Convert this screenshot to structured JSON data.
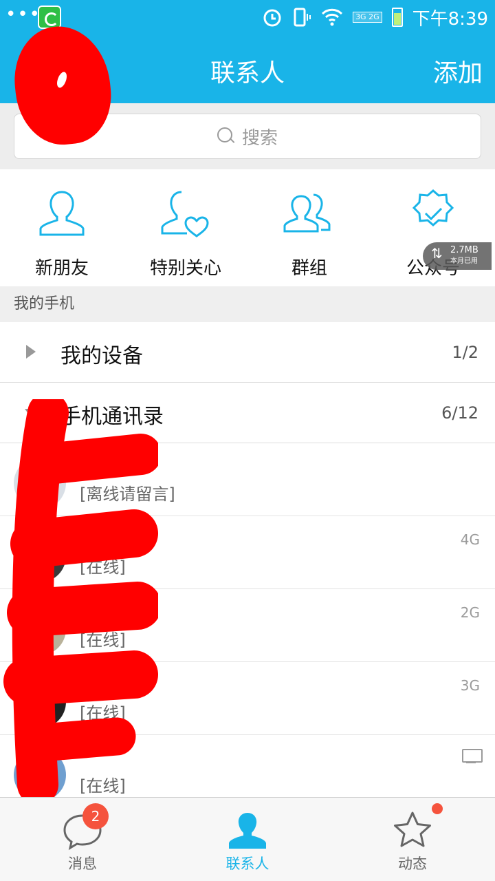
{
  "status_bar": {
    "dots": "•••",
    "net_badge": "3G 2G",
    "time": "下午8:39"
  },
  "header": {
    "title": "联系人",
    "add_label": "添加"
  },
  "search": {
    "placeholder": "搜索"
  },
  "quick_entries": [
    {
      "label": "新朋友",
      "icon": "new-friend-icon"
    },
    {
      "label": "特别关心",
      "icon": "special-care-icon"
    },
    {
      "label": "群组",
      "icon": "group-icon"
    },
    {
      "label": "公众号",
      "icon": "official-account-icon"
    }
  ],
  "traffic_overlay": {
    "value": "2.7MB",
    "sub": "本月已用"
  },
  "section": {
    "title": "我的手机"
  },
  "groups": [
    {
      "name": "我的设备",
      "count": "1/2",
      "expanded": false
    },
    {
      "name": "手机通讯录",
      "count": "6/12",
      "expanded": true
    }
  ],
  "contacts": [
    {
      "name": "",
      "status": "[离线请留言]",
      "network": ""
    },
    {
      "name": "",
      "status": "[在线]",
      "network": "4G"
    },
    {
      "name": "",
      "status": "[在线]",
      "network": "2G"
    },
    {
      "name": "",
      "status": "[在线]",
      "network": "3G"
    },
    {
      "name": "",
      "status": "[在线]",
      "network": "pc-icon"
    }
  ],
  "bottom_nav": {
    "messages_label": "消息",
    "messages_badge": "2",
    "contacts_label": "联系人",
    "feed_label": "动态"
  },
  "colors": {
    "brand": "#19b4e8",
    "badge": "#f5533d"
  }
}
